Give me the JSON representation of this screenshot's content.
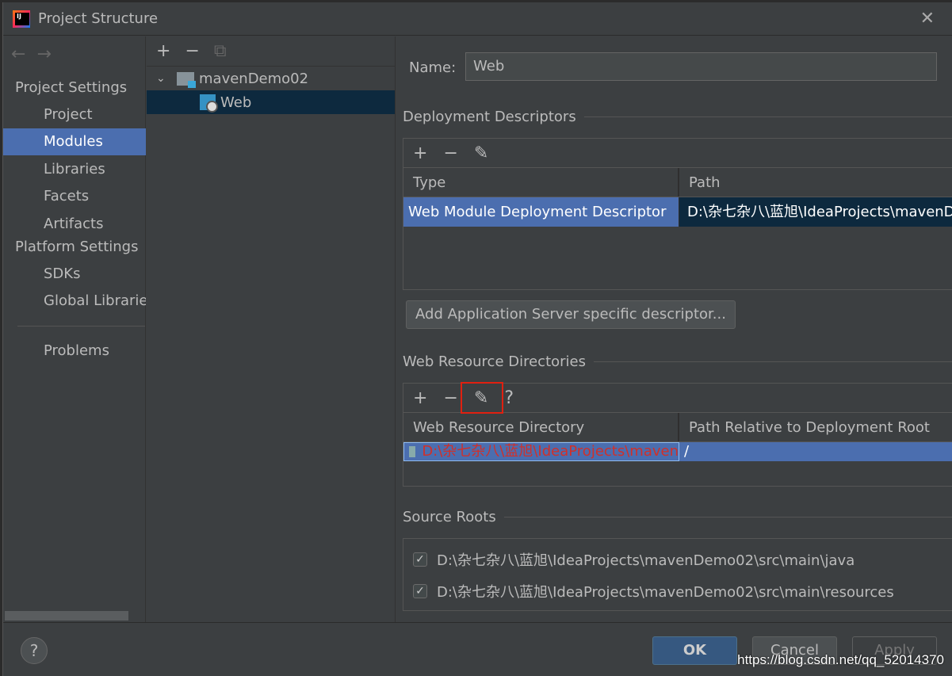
{
  "window": {
    "title": "Project Structure",
    "close": "✕"
  },
  "sidebar": {
    "nav": {
      "back": "←",
      "forward": "→"
    },
    "project_settings": "Project Settings",
    "items": [
      {
        "label": "Project"
      },
      {
        "label": "Modules"
      },
      {
        "label": "Libraries"
      },
      {
        "label": "Facets"
      },
      {
        "label": "Artifacts"
      }
    ],
    "platform_settings": "Platform Settings",
    "platform_items": [
      {
        "label": "SDKs"
      },
      {
        "label": "Global Libraries"
      }
    ],
    "problems": "Problems"
  },
  "tree": {
    "toolbar": {
      "add": "+",
      "remove": "−",
      "copy": "⧉"
    },
    "root": "mavenDemo02",
    "child": "Web",
    "expand": "⌄"
  },
  "detail": {
    "name_label": "Name:",
    "name_value": "Web",
    "deployment": {
      "title": "Deployment Descriptors",
      "toolbar": {
        "add": "+",
        "remove": "−",
        "edit": "✎"
      },
      "columns": [
        "Type",
        "Path"
      ],
      "rows": [
        {
          "type": "Web Module Deployment Descriptor",
          "path": "D:\\杂七杂八\\蓝旭\\IdeaProjects\\mavenDe"
        }
      ],
      "add_button": "Add Application Server specific descriptor..."
    },
    "web_resources": {
      "title": "Web Resource Directories",
      "toolbar": {
        "add": "+",
        "remove": "−",
        "edit": "✎",
        "help": "?"
      },
      "columns": [
        "Web Resource Directory",
        "Path Relative to Deployment Root"
      ],
      "rows": [
        {
          "dir": "D:\\杂七杂八\\蓝旭\\IdeaProjects\\maven",
          "rel": "/"
        }
      ]
    },
    "source_roots": {
      "title": "Source Roots",
      "items": [
        {
          "path": "D:\\杂七杂八\\蓝旭\\IdeaProjects\\mavenDemo02\\src\\main\\java",
          "checked": true
        },
        {
          "path": "D:\\杂七杂八\\蓝旭\\IdeaProjects\\mavenDemo02\\src\\main\\resources",
          "checked": true
        }
      ]
    }
  },
  "footer": {
    "help": "?",
    "ok": "OK",
    "cancel": "Cancel",
    "apply": "Apply",
    "watermark": "https://blog.csdn.net/qq_52014370"
  },
  "colors": {
    "selection": "#4b6eaf",
    "tree_selection": "#0d293e",
    "highlight_box": "#e02010",
    "error_text": "#d0302a",
    "ok_button": "#365880"
  }
}
